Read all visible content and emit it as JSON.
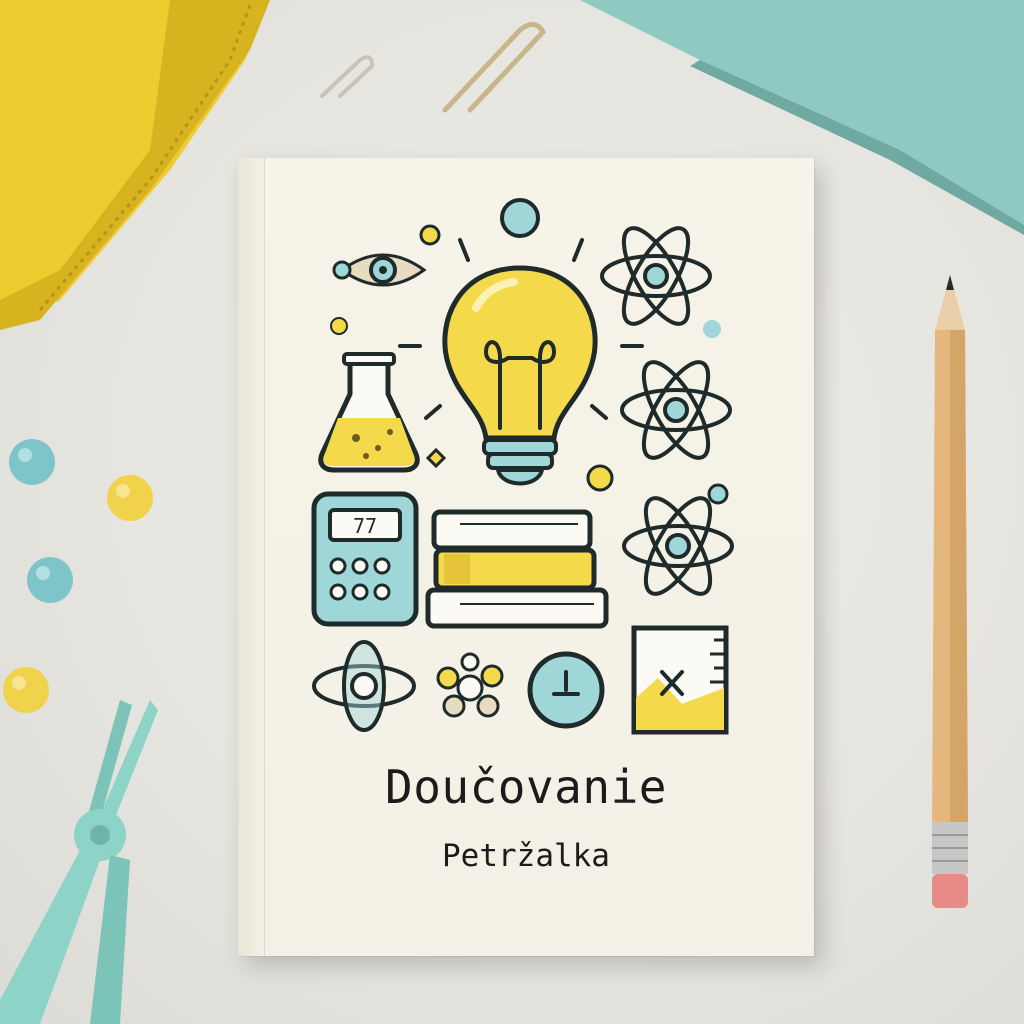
{
  "cover": {
    "title": "Doučovanie",
    "subtitle": "Petržalka",
    "calculator_display": "77"
  },
  "icons": [
    "lightbulb-icon",
    "flask-icon",
    "atom-icon",
    "calculator-icon",
    "books-icon",
    "eye-icon",
    "clock-icon",
    "ruler-chart-icon",
    "molecule-icon"
  ],
  "colors": {
    "yellow": "#f4d94a",
    "teal": "#9fd6d8",
    "outline": "#1f2a2b",
    "paper": "#f4f1e6",
    "desk": "#e7e6e1",
    "notebook_yellow": "#eecb2f",
    "folder_teal": "#8ec9c2",
    "pliers_teal": "#8dd3c8"
  }
}
